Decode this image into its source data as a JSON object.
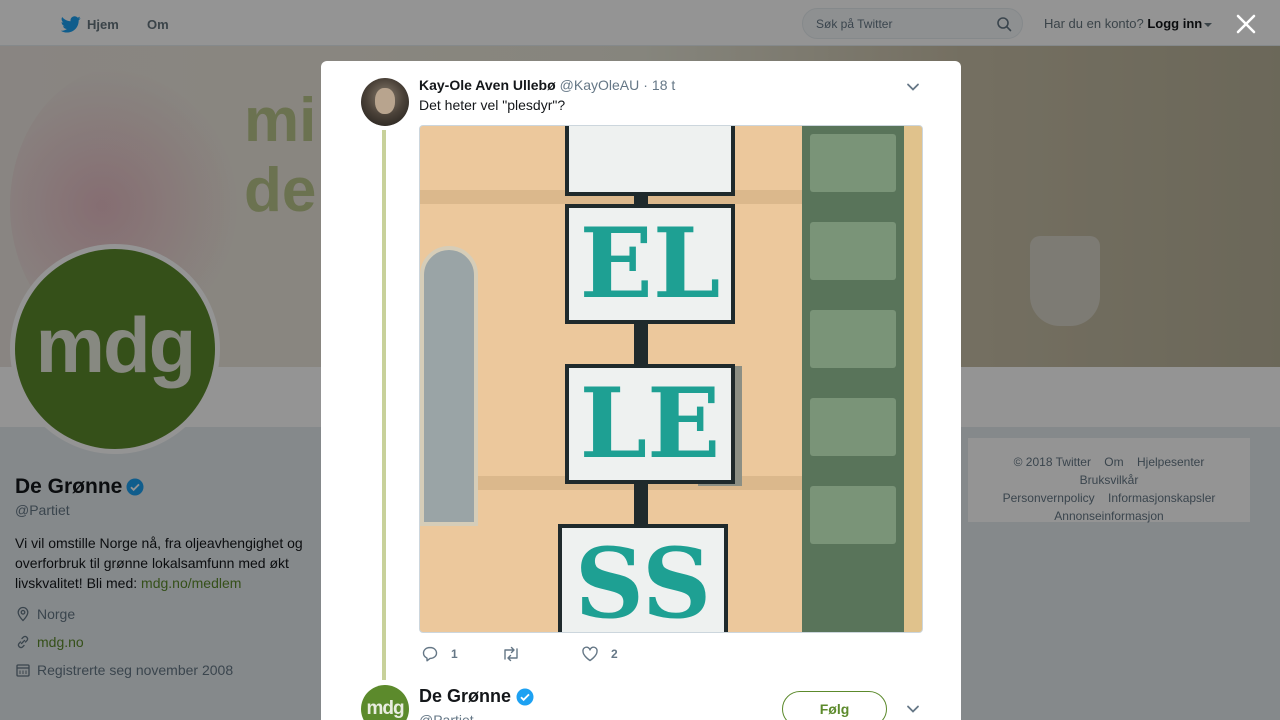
{
  "colors": {
    "accent": "#5c8a2c",
    "twitter_blue": "#1da1f2",
    "verified": "#1da1f2",
    "sign_teal": "#1ea093"
  },
  "nav": {
    "home": {
      "label": "Hjem",
      "icon": "twitter-bird-icon"
    },
    "about": "Om",
    "search": {
      "placeholder": "Søk på Twitter",
      "value": ""
    },
    "login_prompt": "Har du en konto?",
    "login_label": "Logg inn"
  },
  "banner": {
    "slogan_line1": "mi",
    "slogan_line2": "de"
  },
  "profile": {
    "avatar_text": "mdg",
    "name": "De Grønne",
    "handle": "@Partiet",
    "bio": "Vi vil omstille Norge nå, fra oljeavhengighet og overforbruk til grønne lokalsamfunn med økt livskvalitet! Bli med: ",
    "bio_link": "mdg.no/medlem",
    "location": "Norge",
    "website": "mdg.no",
    "joined": "Registrerte seg november 2008"
  },
  "footer": {
    "links": [
      "© 2018 Twitter",
      "Om",
      "Hjelpesenter",
      "Bruksvilkår",
      "Personvernpolicy",
      "Informasjonskapsler",
      "Annonseinformasjon"
    ]
  },
  "tweet": {
    "author_name": "Kay-Ole Aven Ullebø",
    "author_handle": "@KayOleAU",
    "separator": "·",
    "time": "18 t",
    "text": "Det heter vel \"plesdyr\"?",
    "image": {
      "sign_letters": [
        "EL",
        "LE",
        "SS"
      ]
    },
    "actions": {
      "replies": "1",
      "retweets": "",
      "likes": "2"
    }
  },
  "next_tweet": {
    "avatar_text": "mdg",
    "name": "De Grønne",
    "handle": "@Partiet",
    "follow_label": "Følg"
  }
}
